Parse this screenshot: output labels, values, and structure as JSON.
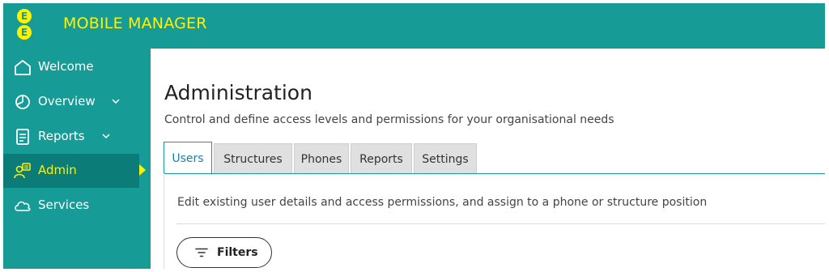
{
  "app": {
    "title": "MOBILE MANAGER",
    "logo_letters": [
      "E",
      "E"
    ],
    "colors": {
      "brand_teal": "#169b96",
      "active_teal": "#0b7c78",
      "accent_yellow": "#fff200",
      "tab_link_blue": "#1a7fb0"
    }
  },
  "sidebar": {
    "items": [
      {
        "label": "Welcome",
        "icon": "home-icon",
        "has_chevron": false,
        "active": false
      },
      {
        "label": "Overview",
        "icon": "pie-chart-icon",
        "has_chevron": true,
        "active": false
      },
      {
        "label": "Reports",
        "icon": "document-icon",
        "has_chevron": true,
        "active": false
      },
      {
        "label": "Admin",
        "icon": "admin-icon",
        "has_chevron": false,
        "active": true
      },
      {
        "label": "Services",
        "icon": "cloud-icon",
        "has_chevron": false,
        "active": false
      }
    ]
  },
  "main": {
    "title": "Administration",
    "subtitle": "Control and define access levels and permissions for your organisational needs",
    "tabs": [
      {
        "label": "Users",
        "active": true
      },
      {
        "label": "Structures",
        "active": false
      },
      {
        "label": "Phones",
        "active": false
      },
      {
        "label": "Reports",
        "active": false
      },
      {
        "label": "Settings",
        "active": false
      }
    ],
    "tab_description": "Edit existing user details and access permissions, and assign to a phone or structure position",
    "filters_button": {
      "label": "Filters",
      "icon": "filter-icon"
    }
  }
}
